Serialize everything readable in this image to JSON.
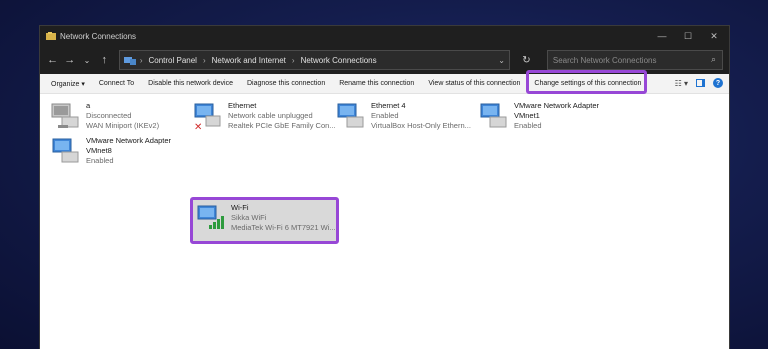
{
  "window": {
    "title": "Network Connections",
    "controls": [
      "—",
      "☐",
      "✕"
    ]
  },
  "address": {
    "crumbs": [
      "Control Panel",
      "Network and Internet",
      "Network Connections"
    ],
    "search_placeholder": "Search Network Connections"
  },
  "toolbar": {
    "organize": "Organize ▾",
    "connect_to": "Connect To",
    "disable": "Disable this network device",
    "diagnose": "Diagnose this connection",
    "rename": "Rename this connection",
    "view_status": "View status of this connection",
    "change_settings": "Change settings of this connection",
    "highlight_color": "#9747d6"
  },
  "connections": [
    {
      "name": "a",
      "status": "Disconnected",
      "device": "WAN Miniport (IKEv2)",
      "icon": "network-adapter-icon"
    },
    {
      "name": "Ethernet",
      "status": "Network cable unplugged",
      "device": "Realtek PCIe GbE Family Con...",
      "icon": "ethernet-unplugged-icon"
    },
    {
      "name": "Ethernet 4",
      "status": "Enabled",
      "device": "VirtualBox Host-Only Ethern...",
      "icon": "network-adapter-icon"
    },
    {
      "name": "VMware Network Adapter VMnet1",
      "status": "Enabled",
      "device": "",
      "icon": "network-adapter-icon"
    },
    {
      "name": "VMware Network Adapter VMnet8",
      "status": "Enabled",
      "device": "",
      "icon": "network-adapter-icon"
    },
    {
      "name": "Wi-Fi",
      "status": "Sikka WiFi",
      "device": "MediaTek Wi-Fi 6 MT7921 Wi...",
      "icon": "wifi-adapter-icon"
    }
  ]
}
